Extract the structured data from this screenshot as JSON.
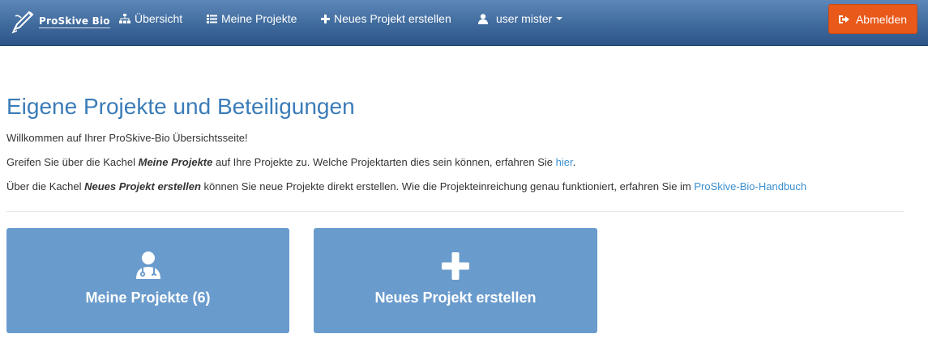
{
  "navbar": {
    "brand": "ProSkive Bio",
    "items": [
      {
        "label": "Übersicht",
        "icon": "sitemap-icon"
      },
      {
        "label": "Meine Projekte",
        "icon": "list-icon"
      },
      {
        "label": "Neues Projekt erstellen",
        "icon": "plus-icon"
      },
      {
        "label": "user mister",
        "icon": "user-icon"
      }
    ],
    "logout": {
      "label": "Abmelden",
      "icon": "sign-out-icon"
    }
  },
  "main": {
    "title": "Eigene Projekte und Beteiligungen",
    "welcome": "Willkommen auf Ihrer ProSkive-Bio Übersichtsseite!",
    "line2": {
      "pre": "Greifen Sie über die Kachel ",
      "emph": "Meine Projekte",
      "mid": " auf Ihre Projekte zu. Welche Projektarten dies sein können, erfahren Sie ",
      "link": "hier",
      "post": "."
    },
    "line3": {
      "pre": "Über die Kachel ",
      "emph": "Neues Projekt erstellen",
      "mid": " können Sie neue Projekte direkt erstellen. Wie die Projekteinreichung genau funktioniert, erfahren Sie im ",
      "link": "ProSkive-Bio-Handbuch"
    }
  },
  "tiles": [
    {
      "label": "Meine Projekte (6)",
      "icon": "user-doctor-icon"
    },
    {
      "label": "Neues Projekt erstellen",
      "icon": "plus-icon"
    }
  ],
  "colors": {
    "navbar": "#3f6a9c",
    "logout": "#e8591a",
    "tile": "#6a9bcd",
    "title": "#3b7cb8",
    "link": "#3b8fd0"
  }
}
